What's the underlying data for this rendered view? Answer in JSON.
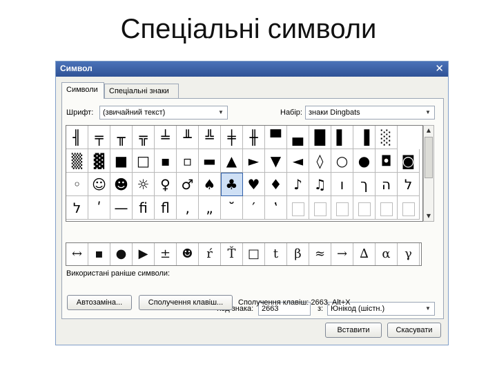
{
  "slide": {
    "title": "Спеціальні символи"
  },
  "dialog": {
    "title": "Символ",
    "close_glyph": "✕",
    "tabs": [
      {
        "label": "Символи"
      },
      {
        "label": "Спеціальні знаки"
      }
    ],
    "font": {
      "label": "Шрифт:",
      "value": "(звичайний текст)"
    },
    "subset": {
      "label": "Набір:",
      "value": "знаки Dingbats"
    },
    "symbols": [
      [
        "╢",
        "╤",
        "╥",
        "╦",
        "╧",
        "╨",
        "╩",
        "╪",
        "╫",
        "▀",
        "▄",
        "█",
        "▌",
        "▐",
        "░"
      ],
      [
        "▒",
        "▓",
        "■",
        "□",
        "▪",
        "▫",
        "▬",
        "▲",
        "►",
        "▼",
        "◄",
        "◊",
        "○",
        "●",
        "◘",
        "◙"
      ],
      [
        "◦",
        "☺",
        "☻",
        "☼",
        "♀",
        "♂",
        "♠",
        "♣",
        "♥",
        "♦",
        "♪",
        "♫",
        "ו",
        "ך",
        "ה",
        "ל"
      ],
      [
        "ל",
        "ʹ",
        "—",
        "ﬁ",
        "ﬂ",
        "‚",
        "„",
        "˘",
        "′",
        "‛",
        "",
        "",
        "",
        "",
        "",
        ""
      ]
    ],
    "selected_symbol": "♣",
    "recent_label": "Використані раніше символи:",
    "recent_symbols": [
      "↔",
      "▪",
      "●",
      "▶",
      "±",
      "☻",
      "ŕ",
      "Ť",
      "□",
      "t",
      "β",
      "≈",
      "→",
      "∆",
      "α",
      "γ"
    ],
    "char_code": {
      "label": "Код знака:",
      "value": "2663"
    },
    "from": {
      "label": "з:",
      "value": "Юнікод (шістн.)"
    },
    "autocorrect_label": "Автозаміна...",
    "shortcut_button_label": "Сполучення клавіш...",
    "shortcut_info": "Сполучення клавіш: 2663, Alt+X",
    "insert_label": "Вставити",
    "cancel_label": "Скасувати"
  }
}
